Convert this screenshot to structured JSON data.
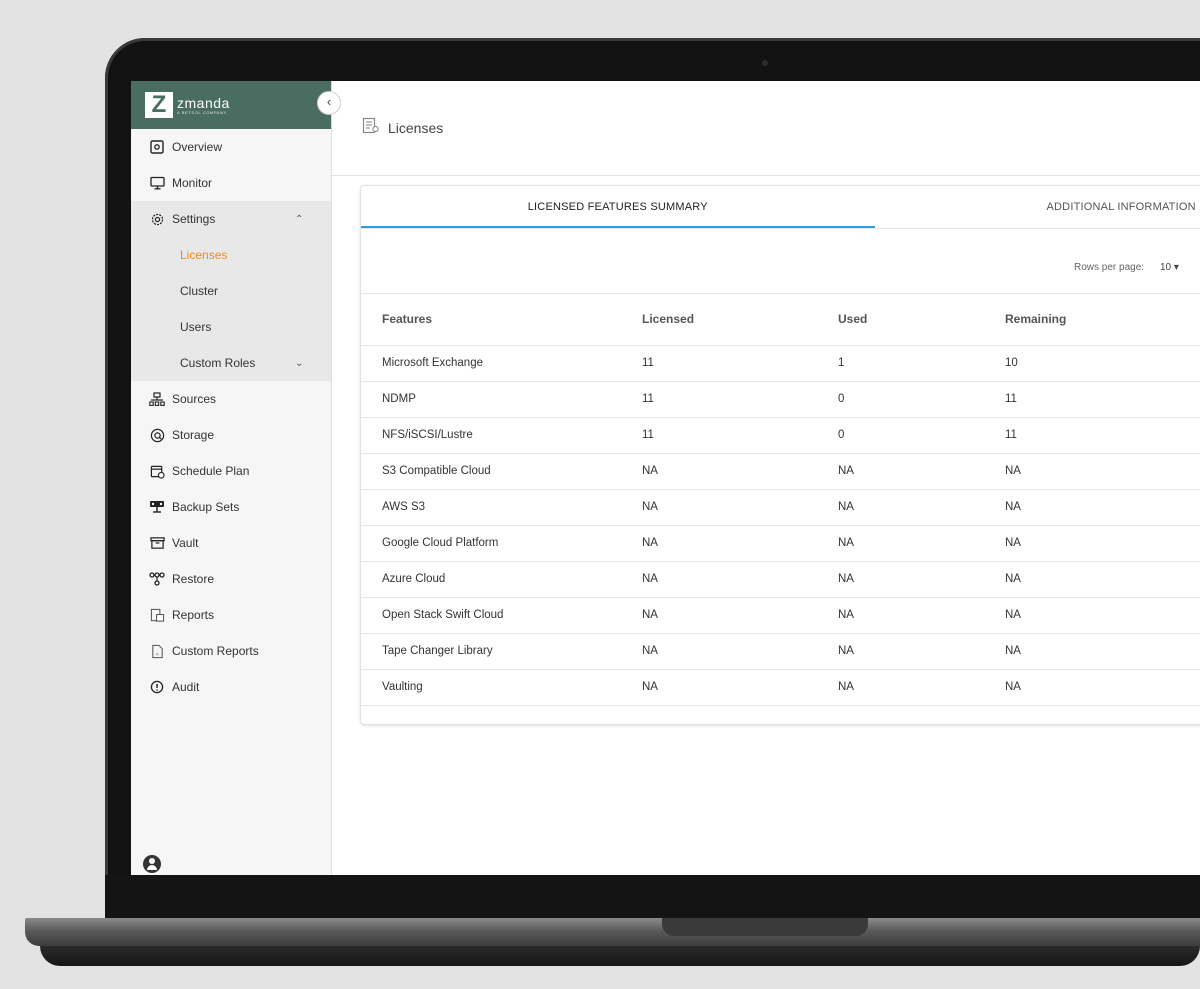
{
  "brand": {
    "name": "zmanda",
    "tagline": "A BETSOL COMPANY",
    "mark": "Z"
  },
  "sidebar": {
    "items": [
      {
        "label": "Overview",
        "icon": "overview-icon"
      },
      {
        "label": "Monitor",
        "icon": "monitor-icon"
      },
      {
        "label": "Settings",
        "icon": "gear-icon",
        "expanded": true
      },
      {
        "label": "Sources",
        "icon": "sources-icon"
      },
      {
        "label": "Storage",
        "icon": "storage-icon"
      },
      {
        "label": "Schedule Plan",
        "icon": "calendar-icon"
      },
      {
        "label": "Backup Sets",
        "icon": "backup-sets-icon"
      },
      {
        "label": "Vault",
        "icon": "vault-icon"
      },
      {
        "label": "Restore",
        "icon": "restore-icon"
      },
      {
        "label": "Reports",
        "icon": "reports-icon"
      },
      {
        "label": "Custom Reports",
        "icon": "custom-reports-icon"
      },
      {
        "label": "Audit",
        "icon": "audit-icon"
      }
    ],
    "settings_sub": [
      {
        "label": "Licenses",
        "active": true
      },
      {
        "label": "Cluster"
      },
      {
        "label": "Users"
      },
      {
        "label": "Custom Roles"
      }
    ]
  },
  "header": {
    "title": "Licenses"
  },
  "tabs": [
    {
      "label": "LICENSED FEATURES SUMMARY",
      "active": true
    },
    {
      "label": "ADDITIONAL INFORMATION"
    }
  ],
  "pagination": {
    "rows_label": "Rows per page:",
    "rows_value": "10"
  },
  "table": {
    "columns": [
      "Features",
      "Licensed",
      "Used",
      "Remaining"
    ],
    "rows": [
      [
        "Microsoft Exchange",
        "11",
        "1",
        "10"
      ],
      [
        "NDMP",
        "11",
        "0",
        "11"
      ],
      [
        "NFS/iSCSI/Lustre",
        "11",
        "0",
        "11"
      ],
      [
        "S3 Compatible Cloud",
        "NA",
        "NA",
        "NA"
      ],
      [
        "AWS S3",
        "NA",
        "NA",
        "NA"
      ],
      [
        "Google Cloud Platform",
        "NA",
        "NA",
        "NA"
      ],
      [
        "Azure Cloud",
        "NA",
        "NA",
        "NA"
      ],
      [
        "Open Stack Swift Cloud",
        "NA",
        "NA",
        "NA"
      ],
      [
        "Tape Changer Library",
        "NA",
        "NA",
        "NA"
      ],
      [
        "Vaulting",
        "NA",
        "NA",
        "NA"
      ]
    ]
  },
  "colors": {
    "brand": "#4a6d61",
    "active_link": "#f08a24",
    "tab_indicator": "#2e9ae2"
  }
}
